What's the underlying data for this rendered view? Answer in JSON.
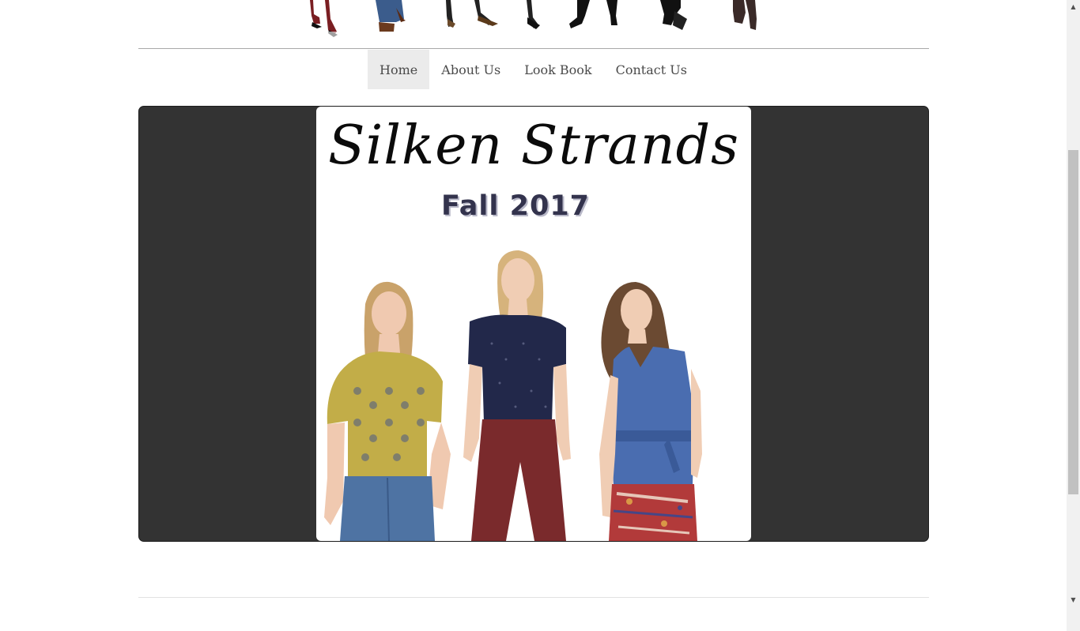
{
  "nav": {
    "items": [
      {
        "label": "Home",
        "active": true
      },
      {
        "label": "About Us",
        "active": false
      },
      {
        "label": "Look Book",
        "active": false
      },
      {
        "label": "Contact Us",
        "active": false
      }
    ]
  },
  "slide": {
    "brand": "Silken Strands",
    "season": "Fall 2017"
  },
  "colors": {
    "slideshow_bg": "#333333",
    "nav_active_bg": "#ebebeb",
    "text": "#4a4a4a"
  },
  "scrollbar": {
    "up_icon": "triangle-up-icon",
    "down_icon": "triangle-down-icon"
  }
}
